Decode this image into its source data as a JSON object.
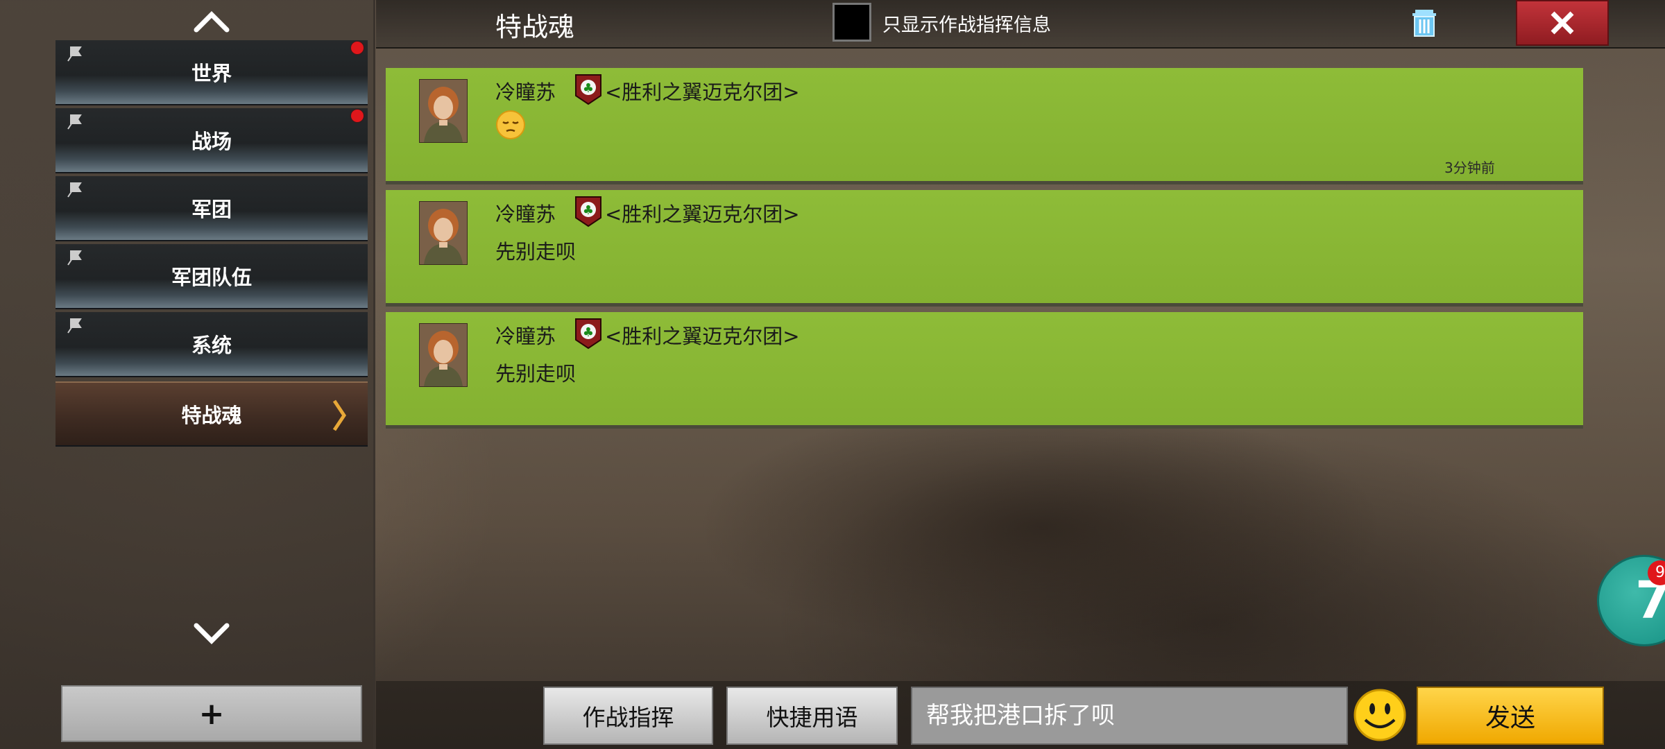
{
  "sidebar": {
    "channels": [
      {
        "label": "世界",
        "has_unread": true
      },
      {
        "label": "战场",
        "has_unread": true
      },
      {
        "label": "军团",
        "has_unread": false
      },
      {
        "label": "军团队伍",
        "has_unread": false
      },
      {
        "label": "系统",
        "has_unread": false
      },
      {
        "label": "特战魂",
        "active": true
      }
    ],
    "add_label": "+"
  },
  "header": {
    "title": "特战魂",
    "filter_label": "只显示作战指挥信息"
  },
  "messages": [
    {
      "sender": "冷瞳苏",
      "legion": "<胜利之翼迈克尔团>",
      "content": "pensive-face-emoji",
      "time": "3分钟前"
    },
    {
      "sender": "冷瞳苏",
      "legion": "<胜利之翼迈克尔团>",
      "content": "先别走呗"
    },
    {
      "sender": "冷瞳苏",
      "legion": "<胜利之翼迈克尔团>",
      "content": "先别走呗"
    }
  ],
  "composer": {
    "command_label": "作战指挥",
    "quick_label": "快捷用语",
    "input_value": "帮我把港口拆了呗",
    "send_label": "发送"
  },
  "floater": {
    "number": "7",
    "badge": "9"
  },
  "colors": {
    "message_bg": "#8ebc38",
    "send": "#f5b800",
    "close": "#b52a31"
  }
}
